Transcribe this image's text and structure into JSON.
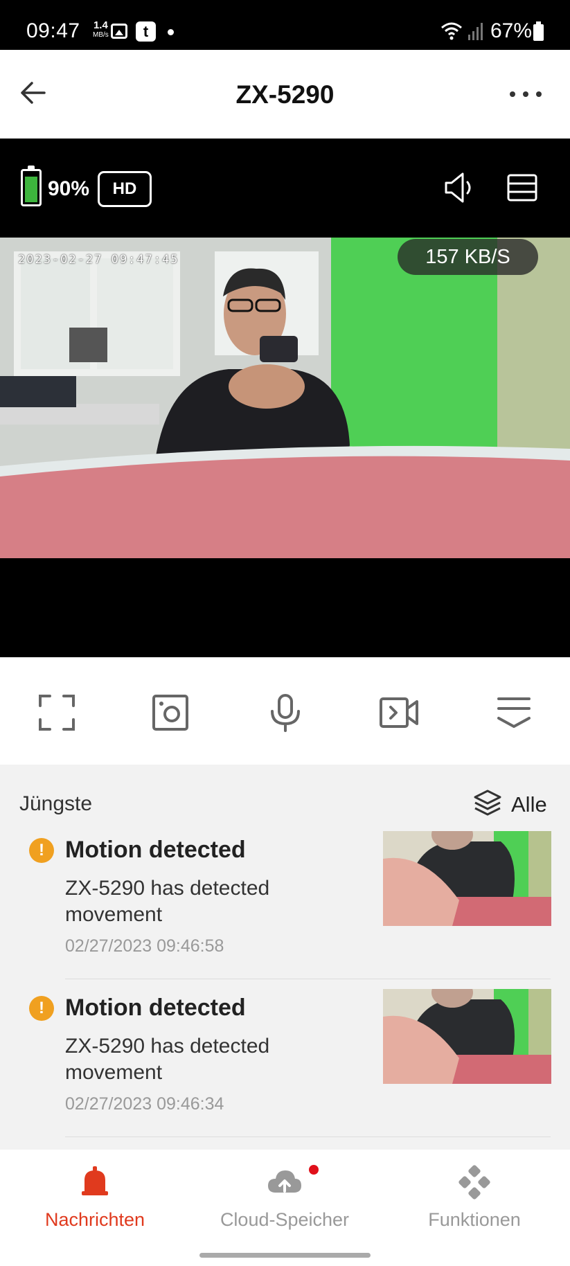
{
  "status_bar": {
    "time": "09:47",
    "net_speed_value": "1.4",
    "net_speed_unit": "MB/s",
    "tapp_letter": "t",
    "battery": "67%"
  },
  "header": {
    "title": "ZX-5290"
  },
  "video": {
    "battery_percent": "90%",
    "battery_level": 0.9,
    "quality_label": "HD",
    "timestamp_overlay": "2023-02-27 09:47:45",
    "bitrate": "157 KB/S"
  },
  "recent": {
    "heading": "Jüngste",
    "all_label": "Alle",
    "events": [
      {
        "title": "Motion detected",
        "description": "ZX-5290 has detected movement",
        "time": "02/27/2023 09:46:58"
      },
      {
        "title": "Motion detected",
        "description": "ZX-5290 has detected movement",
        "time": "02/27/2023 09:46:34"
      }
    ]
  },
  "bottom_nav": {
    "items": [
      {
        "label": "Nachrichten",
        "icon": "bell-icon",
        "active": true
      },
      {
        "label": "Cloud-Speicher",
        "icon": "cloud-upload-icon",
        "active": false
      },
      {
        "label": "Funktionen",
        "icon": "features-grid-icon",
        "active": false
      }
    ]
  },
  "colors": {
    "accent": "#e03a1e",
    "warning": "#f0a020",
    "battery_green": "#3db53d"
  }
}
